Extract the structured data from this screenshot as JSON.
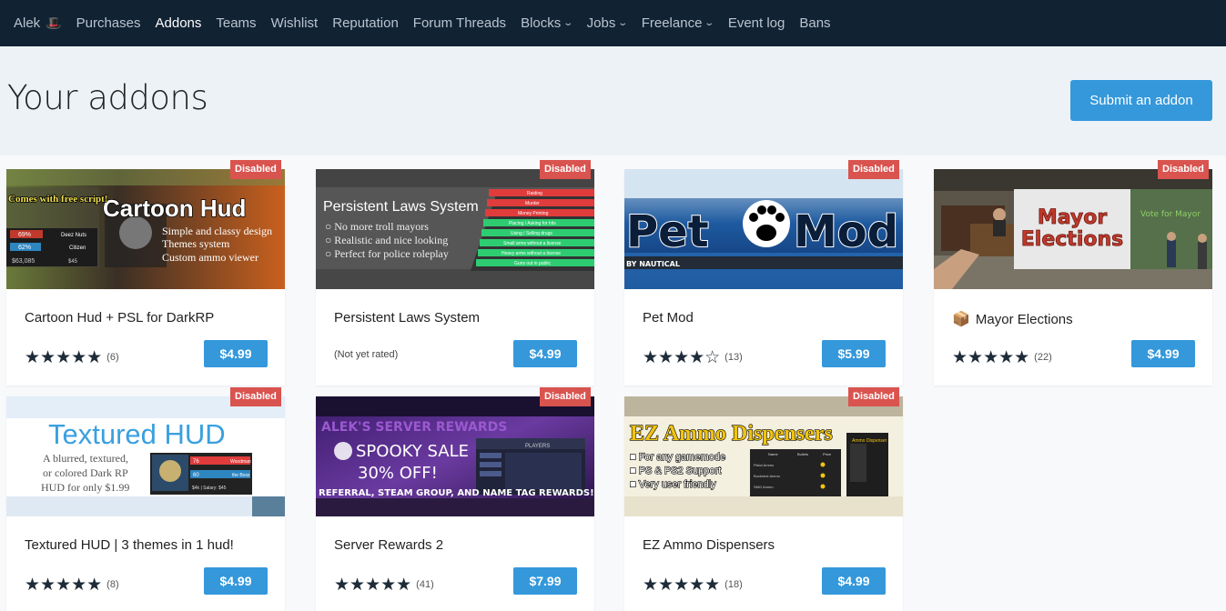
{
  "nav": {
    "user": "Alek",
    "user_icon": "hat-icon",
    "items": [
      {
        "label": "Purchases",
        "active": false
      },
      {
        "label": "Addons",
        "active": true
      },
      {
        "label": "Teams",
        "active": false
      },
      {
        "label": "Wishlist",
        "active": false
      },
      {
        "label": "Reputation",
        "active": false
      },
      {
        "label": "Forum Threads",
        "active": false
      },
      {
        "label": "Blocks",
        "active": false,
        "dropdown": true
      },
      {
        "label": "Jobs",
        "active": false,
        "dropdown": true
      },
      {
        "label": "Freelance",
        "active": false,
        "dropdown": true
      },
      {
        "label": "Event log",
        "active": false
      },
      {
        "label": "Bans",
        "active": false
      }
    ]
  },
  "page": {
    "title": "Your addons",
    "submit_label": "Submit an addon"
  },
  "colors": {
    "nav_bg": "#112233",
    "accent": "#3498db",
    "badge": "#d9534f",
    "star": "#1e2b38"
  },
  "addons": [
    {
      "name": "Cartoon Hud + PSL for DarkRP",
      "badge": "Disabled",
      "stars": "★★★★★",
      "rating": 5,
      "count": "(6)",
      "price": "$4.99",
      "banner": {
        "title": "Cartoon Hud",
        "side": "Comes with free script!",
        "bullets": [
          "Simple and classy design",
          "Themes system",
          "Custom ammo viewer"
        ],
        "hud_left": [
          "69%",
          "62%",
          "$63,085"
        ],
        "hud_right": [
          "Deez Nuts",
          "Citizen",
          "$45"
        ]
      }
    },
    {
      "name": "Persistent Laws System",
      "badge": "Disabled",
      "stars": "",
      "rating": null,
      "count": "",
      "price": "$4.99",
      "unrated": "(Not yet rated)",
      "banner": {
        "title": "Persistent Laws System",
        "bullets": [
          "No more troll mayors",
          "Realistic and nice looking",
          "Perfect for police roleplay"
        ],
        "laws": [
          "Raiding",
          "Murder",
          "Money Printing",
          "Placing / Asking for hits",
          "Using / Selling drugs",
          "Small arms without a license",
          "Heavy arms without a license",
          "Guns out in public"
        ]
      }
    },
    {
      "name": "Pet Mod",
      "badge": "Disabled",
      "stars": "★★★★☆",
      "rating": 4,
      "count": "(13)",
      "price": "$5.99",
      "banner": {
        "title_left": "Pet",
        "title_right": "Mod",
        "byline": "BY NAUTICAL"
      }
    },
    {
      "name": "Mayor Elections",
      "badge": "Disabled",
      "stars": "★★★★★",
      "rating": 5,
      "count": "(22)",
      "price": "$4.99",
      "name_icon": "box-icon",
      "banner": {
        "title": "Mayor Elections",
        "sign": "Vote for Mayor"
      }
    },
    {
      "name": "Textured HUD | 3 themes in 1 hud!",
      "badge": "Disabled",
      "stars": "★★★★★",
      "rating": 5,
      "count": "(8)",
      "price": "$4.99",
      "banner": {
        "title": "Textured HUD",
        "lines": [
          "A blurred, textured,",
          "or colored Dark RP",
          "HUD for only $1.99"
        ],
        "hud": [
          "76",
          "60",
          "Woodman",
          "the Boss",
          "$4k | Salary: $45"
        ]
      }
    },
    {
      "name": "Server Rewards 2",
      "badge": "Disabled",
      "stars": "★★★★★",
      "rating": 5,
      "count": "(41)",
      "price": "$7.99",
      "banner": {
        "title": "ALEK'S SERVER REWARDS",
        "sale": "SPOOKY SALE",
        "off": "30% OFF!",
        "footer": "REFERRAL, STEAM GROUP, AND NAME TAG REWARDS!",
        "panel": "PLAYERS"
      }
    },
    {
      "name": "EZ Ammo Dispensers",
      "badge": "Disabled",
      "stars": "★★★★★",
      "rating": 5,
      "count": "(18)",
      "price": "$4.99",
      "banner": {
        "title": "EZ Ammo Dispensers",
        "bullets": [
          "For any gamemode",
          "PS & PS2 Support",
          "Very user friendly"
        ],
        "table_head": [
          "Name",
          "Bullets",
          "Price"
        ],
        "rows": [
          "Pistol Ammo",
          "Buckshot Ammo",
          "SMG Ammo"
        ],
        "machine": "Ammo Dispenser"
      }
    }
  ]
}
